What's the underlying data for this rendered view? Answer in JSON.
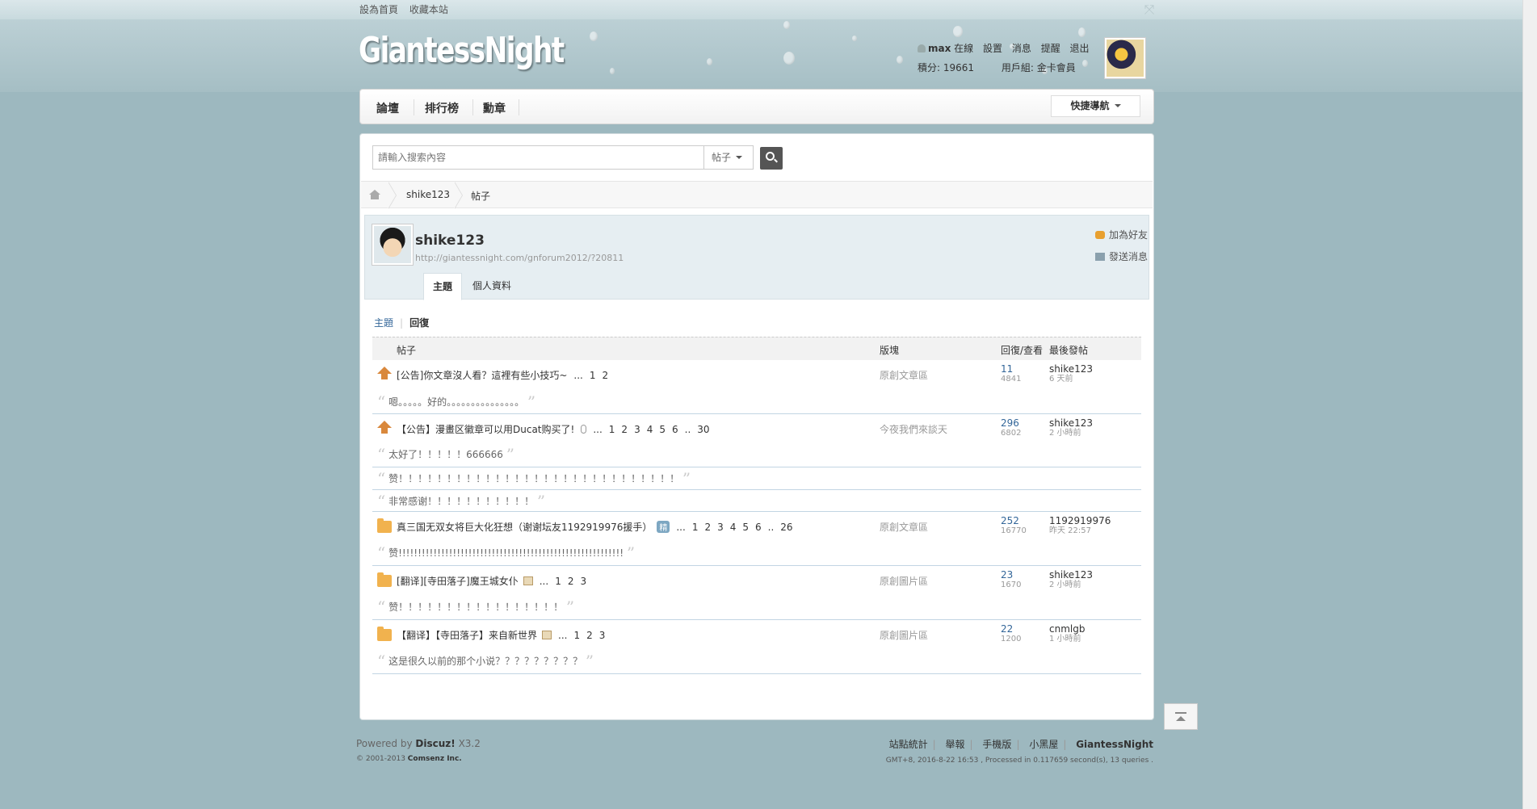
{
  "topbar": {
    "set_home": "設為首頁",
    "bookmark": "收藏本站"
  },
  "site": {
    "logo": "GiantessNight"
  },
  "user": {
    "name": "max",
    "status": "在線",
    "settings": "設置",
    "messages": "消息",
    "reminders": "提醒",
    "logout": "退出",
    "points": "積分: 19661",
    "group": "用戶組: 金卡會員"
  },
  "nav": {
    "items": [
      "論壇",
      "排行榜",
      "勳章"
    ],
    "quick_nav": "快捷導航"
  },
  "search": {
    "placeholder": "請輸入搜索內容",
    "type": "帖子"
  },
  "breadcrumb": {
    "user": "shike123",
    "current": "帖子"
  },
  "profile": {
    "name": "shike123",
    "url": "http://giantessnight.com/gnforum2012/?20811",
    "add_friend": "加為好友",
    "send_message": "發送消息",
    "tabs": [
      "主題",
      "個人資料"
    ]
  },
  "subnav": {
    "topics": "主題",
    "replies": "回復"
  },
  "table": {
    "headers": {
      "post": "帖子",
      "forum": "版塊",
      "replies_views": "回復/查看",
      "last_post": "最後發帖"
    },
    "rows": [
      {
        "icon": "pinned-icon",
        "title": "[公告]你文章沒人看？這裡有些小技巧~",
        "pages": [
          "...",
          "1",
          "2"
        ],
        "forum": "原創文章區",
        "replies": "11",
        "views": "4841",
        "last_user": "shike123",
        "last_time": "6 天前",
        "quotes": [
          "嗯。。。。。好的。。。。。。。。。。。。。。。"
        ]
      },
      {
        "icon": "pinned-icon",
        "title": "【公告】漫畫区徽章可以用Ducat购买了!",
        "pages": [
          "...",
          "1",
          "2",
          "3",
          "4",
          "5",
          "6",
          "..",
          "30"
        ],
        "forum": "今夜我們來談天",
        "replies": "296",
        "views": "6802",
        "last_user": "shike123",
        "last_time": "2 小時前",
        "quotes": [
          "太好了！！！！！666666",
          "赞！！！！！！！！！！！！！！！！！！！！！！！！！！！！！",
          "非常感谢！！！！！！！！！！！"
        ]
      },
      {
        "icon": "folder-icon",
        "title": "真三国无双女将巨大化狂想（谢谢坛友1192919976援手）",
        "badge": "精",
        "pages": [
          "...",
          "1",
          "2",
          "3",
          "4",
          "5",
          "6",
          "..",
          "26"
        ],
        "forum": "原創文章區",
        "replies": "252",
        "views": "16770",
        "last_user": "1192919976",
        "last_time": "昨天 22:57",
        "quotes": [
          "赞!!!!!!!!!!!!!!!!!!!!!!!!!!!!!!!!!!!!!!!!!!!!!!!!!!!!!!!!!!"
        ]
      },
      {
        "icon": "folder-icon",
        "title": "[翻译][寺田落子]魔王城女仆",
        "pages": [
          "...",
          "1",
          "2",
          "3"
        ],
        "forum": "原創圖片區",
        "replies": "23",
        "views": "1670",
        "last_user": "shike123",
        "last_time": "2 小時前",
        "quotes": [
          "赞！！！！！！！！！！！！！！！！！"
        ]
      },
      {
        "icon": "folder-icon",
        "title": "【翻译】【寺田落子】来自新世界",
        "pages": [
          "...",
          "1",
          "2",
          "3"
        ],
        "forum": "原創圖片區",
        "replies": "22",
        "views": "1200",
        "last_user": "cnmlgb",
        "last_time": "1 小時前",
        "quotes": [
          "这是很久以前的那个小说？？？？？？？？？"
        ]
      }
    ]
  },
  "footer": {
    "powered": "Powered by",
    "discuz": "Discuz!",
    "version": "X3.2",
    "copyright": "© 2001-2013",
    "company": "Comsenz Inc.",
    "links": [
      "站點統計",
      "舉報",
      "手機版",
      "小黑屋",
      "GiantessNight"
    ],
    "info": "GMT+8, 2016-8-22 16:53 , Processed in 0.117659 second(s), 13 queries ."
  }
}
